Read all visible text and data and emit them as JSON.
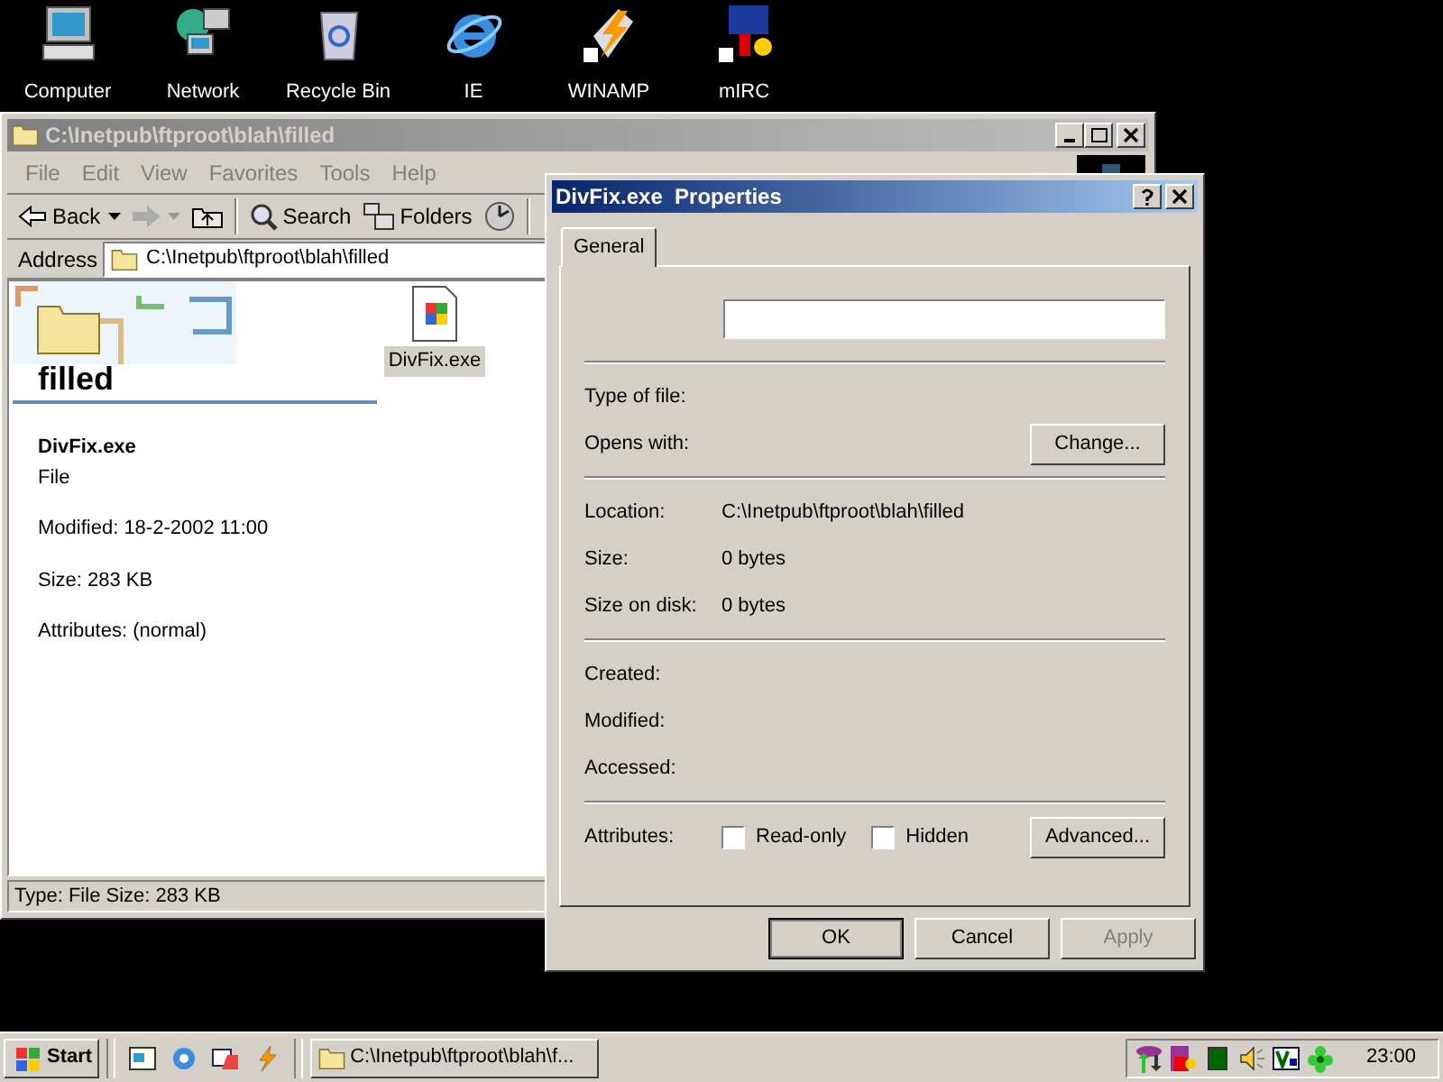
{
  "desktop_icons": [
    {
      "kind": "computer",
      "label": "Computer"
    },
    {
      "kind": "network",
      "label": "Network"
    },
    {
      "kind": "recycle",
      "label": "Recycle Bin"
    },
    {
      "kind": "ie",
      "label": "IE"
    },
    {
      "kind": "winamp",
      "label": "WINAMP"
    },
    {
      "kind": "mirc",
      "label": "mIRC"
    }
  ],
  "explorer": {
    "title": "C:\\Inetpub\\ftproot\\blah\\filled",
    "menu": [
      "File",
      "Edit",
      "View",
      "Favorites",
      "Tools",
      "Help"
    ],
    "toolbar": [
      {
        "kind": "back",
        "label": "Back",
        "disabled": false
      },
      {
        "kind": "forward",
        "disabled": true
      },
      {
        "kind": "up",
        "disabled": false
      },
      {
        "kind": "search",
        "label": "Search",
        "disabled": false
      },
      {
        "kind": "folders",
        "label": "Folders",
        "disabled": false
      },
      {
        "kind": "history",
        "disabled": false
      }
    ],
    "address_label": "Address",
    "address": "C:\\Inetpub\\ftproot\\blah\\filled",
    "folder_name": "filled",
    "details": {
      "name": "DivFix.exe",
      "type": "File",
      "lines": [
        "Modified: 18-2-2002 11:00",
        "Size: 283 KB",
        "Attributes: (normal)"
      ]
    },
    "files": [
      {
        "name": "DivFix.exe",
        "selected": true
      }
    ],
    "status_bar": "Type: File Size: 283 KB"
  },
  "dialog": {
    "title": "DivFix.exe  Properties",
    "tabs": [
      {
        "label": "General",
        "selected": true
      }
    ],
    "sections": [
      [
        {
          "label": "Type of file:"
        },
        {
          "label": "Opens with:",
          "button": "Change..."
        }
      ],
      [
        {
          "label": "Location:",
          "value": "C:\\Inetpub\\ftproot\\blah\\filled"
        },
        {
          "label": "Size:",
          "value": "0 bytes"
        },
        {
          "label": "Size on disk:",
          "value": "0 bytes"
        }
      ],
      [
        {
          "label": "Created:"
        },
        {
          "label": "Modified:"
        },
        {
          "label": "Accessed:"
        }
      ]
    ],
    "attributes_label": "Attributes:",
    "attributes": [
      {
        "label": "Read-only",
        "checked": false
      },
      {
        "label": "Hidden",
        "checked": false
      }
    ],
    "advanced": "Advanced...",
    "buttons": [
      {
        "label": "OK",
        "default": true,
        "disabled": false
      },
      {
        "label": "Cancel",
        "default": false,
        "disabled": false
      },
      {
        "label": "Apply",
        "default": false,
        "disabled": true
      }
    ]
  },
  "taskbar": {
    "start": "Start",
    "quick_launch": [
      {
        "kind": "desktop"
      },
      {
        "kind": "ie"
      },
      {
        "kind": "channels"
      },
      {
        "kind": "winamp"
      }
    ],
    "tasks": [
      {
        "label": "C:\\Inetpub\\ftproot\\blah\\f...",
        "selected": false
      }
    ],
    "tray": [
      {
        "kind": "netlimit"
      },
      {
        "kind": "mirc"
      },
      {
        "kind": "meter"
      },
      {
        "kind": "volume"
      },
      {
        "kind": "tv"
      },
      {
        "kind": "flower"
      }
    ],
    "clock": "23:00"
  }
}
